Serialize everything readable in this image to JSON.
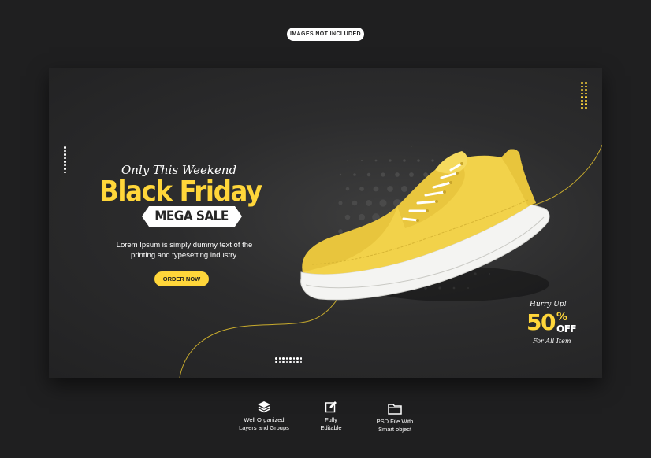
{
  "notice": {
    "label": "IMAGES NOT INCLUDED"
  },
  "banner": {
    "tagline": "Only This Weekend",
    "headline": "Black Friday",
    "badge": "MEGA SALE",
    "description": "Lorem Ipsum is simply dummy text of the printing and typesetting industry.",
    "cta": "ORDER NOW",
    "product_icon": "sneaker-image",
    "discount": {
      "top": "Hurry Up!",
      "number": "50",
      "percent": "%",
      "off": "OFF",
      "bottom": "For All Item"
    }
  },
  "features": [
    {
      "icon": "layers-icon",
      "line1": "Well Organized",
      "line2": "Layers and Groups"
    },
    {
      "icon": "edit-icon",
      "line1": "Fully",
      "line2": "Editable"
    },
    {
      "icon": "folder-icon",
      "line1": "PSD File With",
      "line2": "Smart object"
    }
  ],
  "colors": {
    "background": "#1f1f20",
    "banner": "#2c2c2d",
    "accent": "#ffd63a",
    "text": "#ffffff"
  }
}
